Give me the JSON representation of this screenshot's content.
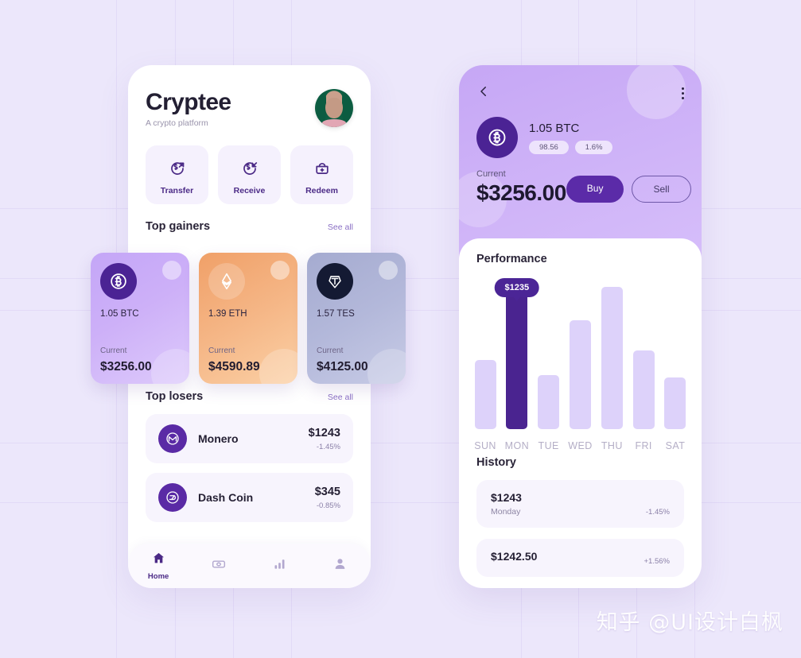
{
  "left_phone": {
    "brand": {
      "title": "Cryptee",
      "subtitle": "A crypto platform"
    },
    "avatar_alt": "user-avatar",
    "actions": [
      {
        "label": "Transfer",
        "icon": "transfer-icon"
      },
      {
        "label": "Receive",
        "icon": "receive-icon"
      },
      {
        "label": "Redeem",
        "icon": "redeem-icon"
      }
    ],
    "top_gainers": {
      "title": "Top gainers",
      "see_all": "See all",
      "cards": [
        {
          "amount": "1.05 BTC",
          "current_label": "Current",
          "price": "$3256.00",
          "symbol": "BTC",
          "icon": "bitcoin-icon"
        },
        {
          "amount": "1.39 ETH",
          "current_label": "Current",
          "price": "$4590.89",
          "symbol": "ETH",
          "icon": "ethereum-icon"
        },
        {
          "amount": "1.57 TES",
          "current_label": "Current",
          "price": "$4125.00",
          "symbol": "TES",
          "icon": "tether-icon"
        }
      ]
    },
    "top_losers": {
      "title": "Top losers",
      "see_all": "See all",
      "rows": [
        {
          "name": "Monero",
          "price": "$1243",
          "change": "-1.45%",
          "icon": "monero-icon"
        },
        {
          "name": "Dash Coin",
          "price": "$345",
          "change": "-0.85%",
          "icon": "dash-icon"
        }
      ]
    },
    "nav": [
      {
        "label": "Home",
        "icon": "home-icon",
        "active": true
      },
      {
        "label": "",
        "icon": "cash-icon",
        "active": false
      },
      {
        "label": "",
        "icon": "bar-chart-icon",
        "active": false
      },
      {
        "label": "",
        "icon": "person-icon",
        "active": false
      }
    ]
  },
  "right_phone": {
    "back_icon": "chevron-left-icon",
    "menu_icon": "kebab-menu-icon",
    "coin": {
      "ticker": "1.05 BTC",
      "icon": "bitcoin-icon",
      "badges": [
        "98.56",
        "1.6%"
      ],
      "current_label": "Current",
      "price": "$3256.00"
    },
    "buttons": {
      "buy": "Buy",
      "sell": "Sell"
    },
    "performance": {
      "title": "Performance",
      "tooltip": "$1235"
    },
    "history": {
      "title": "History",
      "rows": [
        {
          "amount": "$1243",
          "day": "Monday",
          "change": "-1.45%"
        },
        {
          "amount": "$1242.50",
          "day": "",
          "change": "+1.56%"
        }
      ]
    }
  },
  "watermark": "知乎 @UI设计白枫",
  "chart_data": {
    "type": "bar",
    "title": "Performance",
    "categories": [
      "SUN",
      "MON",
      "TUE",
      "WED",
      "THU",
      "FRI",
      "SAT"
    ],
    "values": [
      46,
      100,
      36,
      72,
      94,
      52,
      34
    ],
    "highlight_index": 1,
    "highlight_label": "$1235",
    "xlabel": "",
    "ylabel": "",
    "ylim": [
      0,
      100
    ],
    "grid": false,
    "legend": "none",
    "colors": {
      "bar": "#ddd2fa",
      "bar_active": "#4a2490"
    }
  }
}
